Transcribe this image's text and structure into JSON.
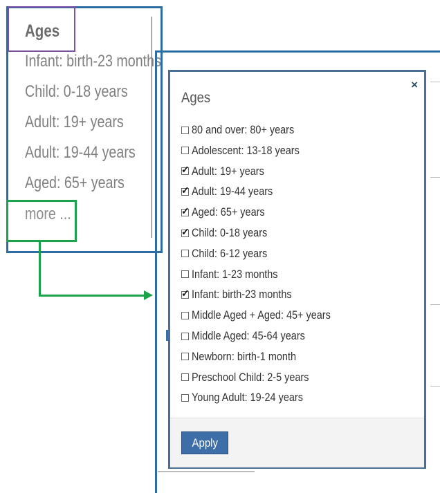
{
  "left_panel": {
    "title": "Ages",
    "items": [
      {
        "label": "Infant: birth-23 months"
      },
      {
        "label": "Child: 0-18 years"
      },
      {
        "label": "Adult: 19+ years"
      },
      {
        "label": "Adult: 19-44 years"
      },
      {
        "label": "Aged: 65+ years"
      }
    ],
    "more_label": "more ..."
  },
  "dialog": {
    "title": "Ages",
    "close_label": "×",
    "options": [
      {
        "label": "80 and over: 80+ years",
        "checked": false
      },
      {
        "label": "Adolescent: 13-18 years",
        "checked": false
      },
      {
        "label": "Adult: 19+ years",
        "checked": true
      },
      {
        "label": "Adult: 19-44 years",
        "checked": true
      },
      {
        "label": "Aged: 65+ years",
        "checked": true
      },
      {
        "label": "Child: 0-18 years",
        "checked": true
      },
      {
        "label": "Child: 6-12 years",
        "checked": false
      },
      {
        "label": "Infant: 1-23 months",
        "checked": false
      },
      {
        "label": "Infant: birth-23 months",
        "checked": true
      },
      {
        "label": "Middle Aged + Aged: 45+ years",
        "checked": false
      },
      {
        "label": "Middle Aged: 45-64 years",
        "checked": false
      },
      {
        "label": "Newborn: birth-1 month",
        "checked": false
      },
      {
        "label": "Preschool Child: 2-5 years",
        "checked": false
      },
      {
        "label": "Young Adult: 19-24 years",
        "checked": false
      }
    ],
    "apply_label": "Apply"
  },
  "colors": {
    "frame_blue": "#2e6da4",
    "highlight_purple": "#7a52a3",
    "highlight_green": "#1aa34a",
    "apply_button": "#3e6ea8"
  }
}
